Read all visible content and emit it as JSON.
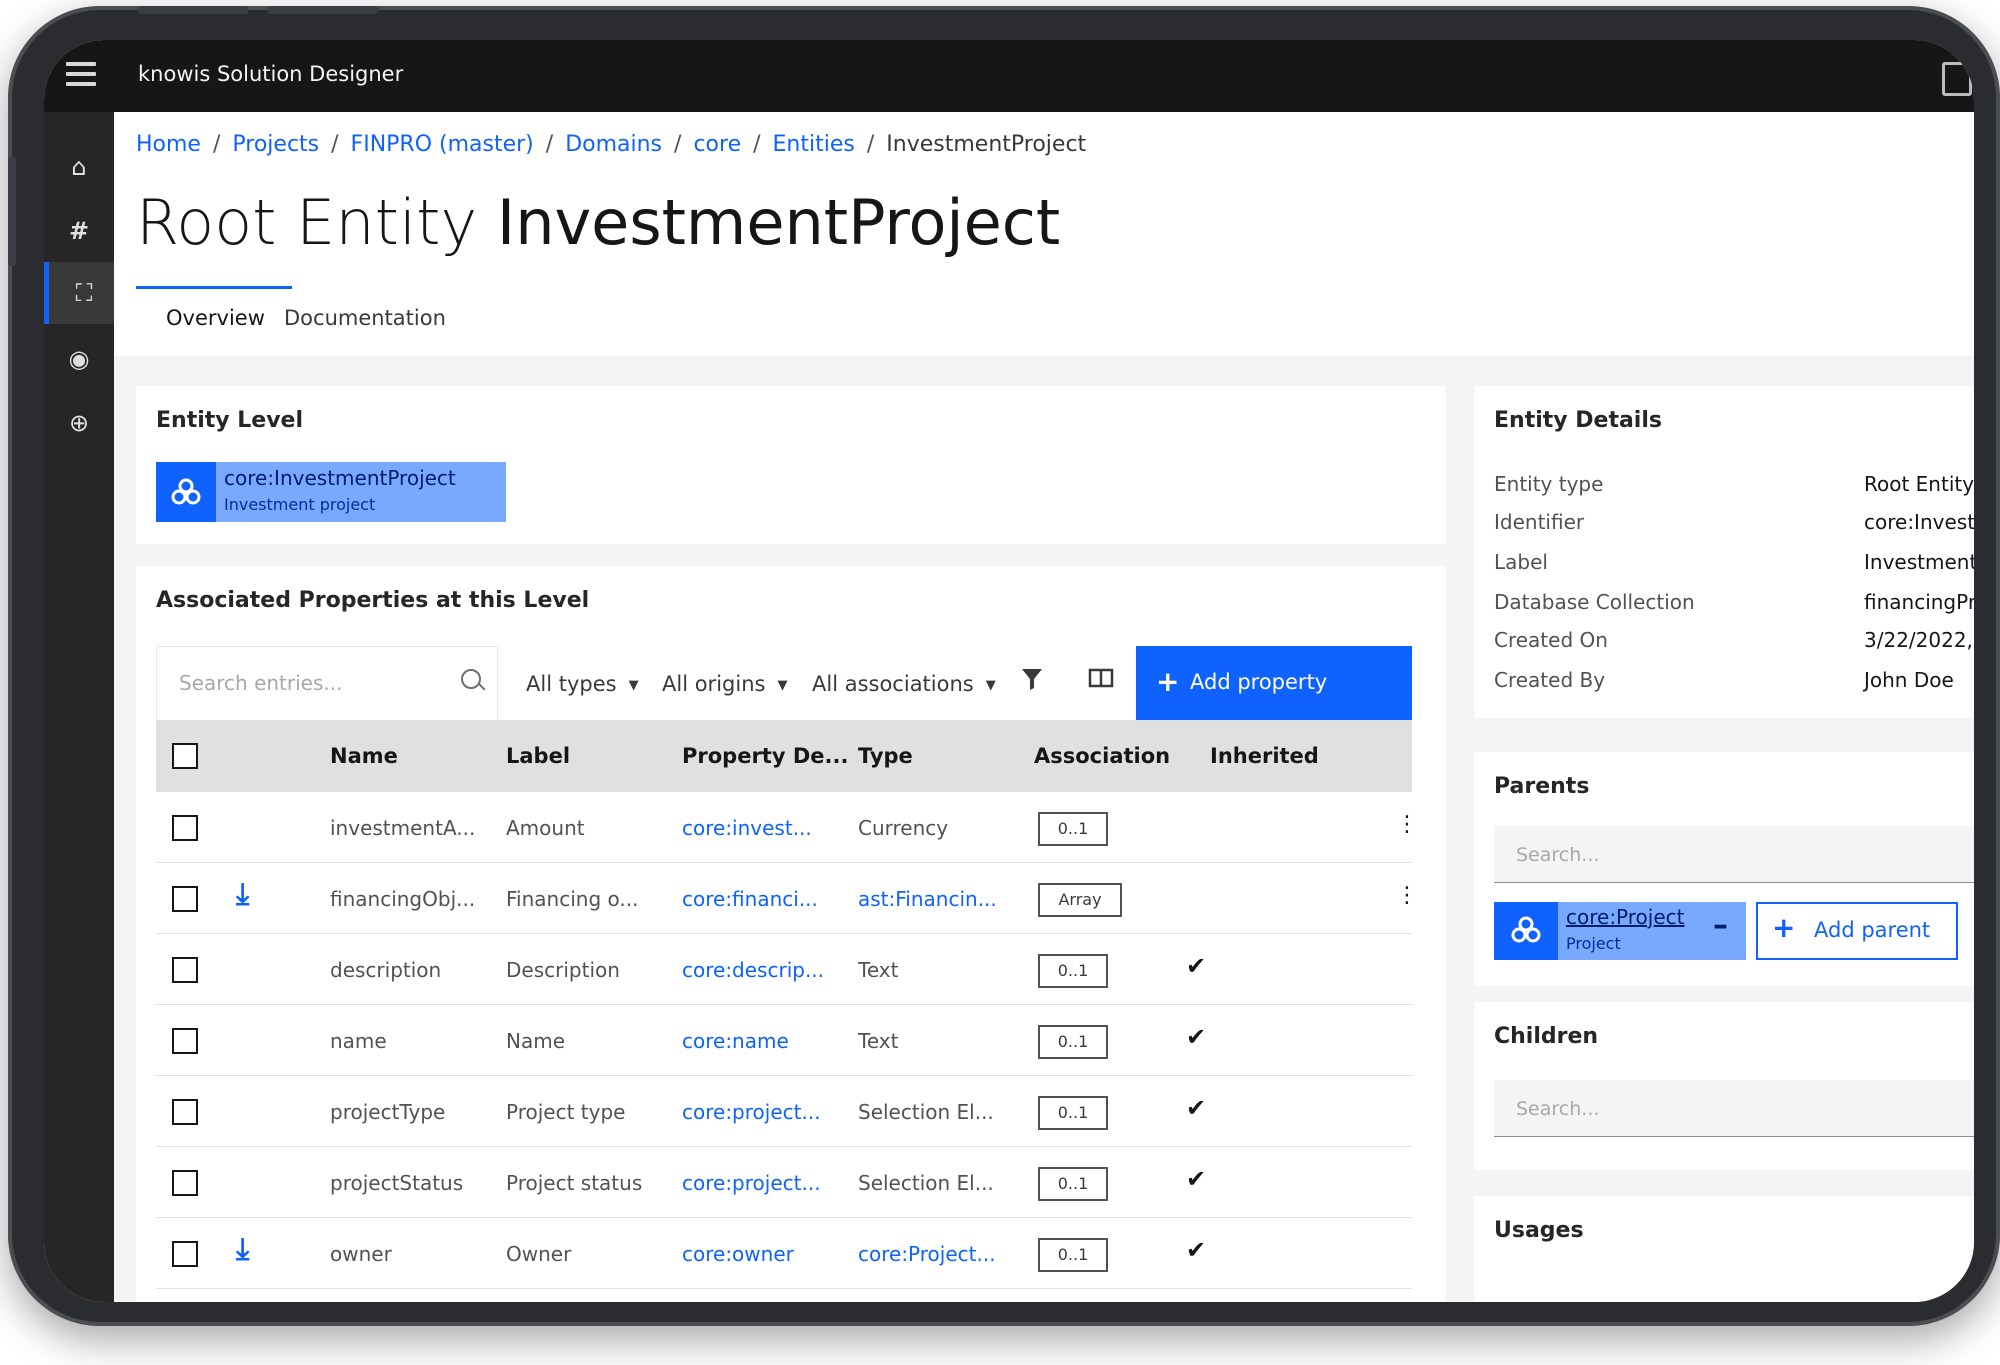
{
  "app": {
    "title": "knowis Solution Designer"
  },
  "sidenav": {
    "items": [
      {
        "name": "home",
        "glyph": "⌂"
      },
      {
        "name": "hash",
        "glyph": "#"
      },
      {
        "name": "focus",
        "glyph": "⛶"
      },
      {
        "name": "target",
        "glyph": "◉"
      },
      {
        "name": "crosshair",
        "glyph": "⊕"
      }
    ],
    "active": "focus"
  },
  "breadcrumb": {
    "home": "Home",
    "projects": "Projects",
    "project": "FINPRO (master)",
    "domains": "Domains",
    "domain": "core",
    "entities": "Entities",
    "current": "InvestmentProject",
    "sep": "/"
  },
  "page": {
    "title_prefix": "Root Entity",
    "title_name": "InvestmentProject"
  },
  "tabs": {
    "overview": "Overview",
    "documentation": "Documentation"
  },
  "entity_level": {
    "title": "Entity Level",
    "tag": {
      "id": "core:InvestmentProject",
      "label": "Investment project"
    }
  },
  "properties": {
    "title": "Associated Properties at this Level",
    "search_placeholder": "Search entries...",
    "filters": {
      "types": "All types",
      "origins": "All origins",
      "associations": "All associations"
    },
    "add_button": "Add property",
    "columns": {
      "name": "Name",
      "label": "Label",
      "property_def": "Property De...",
      "type": "Type",
      "association": "Association",
      "inherited": "Inherited"
    },
    "rows": [
      {
        "name": "investmentA...",
        "label": "Amount",
        "property_def": "core:invest...",
        "type": "Currency",
        "type_link": false,
        "association": "0..1",
        "inherited": "",
        "relation": "",
        "menu": "⋮"
      },
      {
        "name": "financingObj...",
        "label": "Financing o...",
        "property_def": "core:financi...",
        "type": "ast:Financin...",
        "type_link": true,
        "association": "Array",
        "inherited": "",
        "relation": "⤓",
        "menu": "⋮"
      },
      {
        "name": "description",
        "label": "Description",
        "property_def": "core:descrip...",
        "type": "Text",
        "type_link": false,
        "association": "0..1",
        "inherited": "✔",
        "relation": "",
        "menu": ""
      },
      {
        "name": "name",
        "label": "Name",
        "property_def": "core:name",
        "type": "Text",
        "type_link": false,
        "association": "0..1",
        "inherited": "✔",
        "relation": "",
        "menu": ""
      },
      {
        "name": "projectType",
        "label": "Project type",
        "property_def": "core:project...",
        "type": "Selection El...",
        "type_link": false,
        "association": "0..1",
        "inherited": "✔",
        "relation": "",
        "menu": ""
      },
      {
        "name": "projectStatus",
        "label": "Project status",
        "property_def": "core:project...",
        "type": "Selection El...",
        "type_link": false,
        "association": "0..1",
        "inherited": "✔",
        "relation": "",
        "menu": ""
      },
      {
        "name": "owner",
        "label": "Owner",
        "property_def": "core:owner",
        "type": "core:Project...",
        "type_link": true,
        "association": "0..1",
        "inherited": "✔",
        "relation": "⤓",
        "menu": ""
      }
    ]
  },
  "entity_details": {
    "title": "Entity Details",
    "fields": [
      {
        "label": "Entity type",
        "value": "Root Entity"
      },
      {
        "label": "Identifier",
        "value": "core:Invest"
      },
      {
        "label": "Label",
        "value": "Investment"
      },
      {
        "label": "Database Collection",
        "value": "financingPr"
      },
      {
        "label": "Created On",
        "value": "3/22/2022,"
      },
      {
        "label": "Created By",
        "value": "John Doe"
      }
    ]
  },
  "parents": {
    "title": "Parents",
    "search_placeholder": "Search...",
    "tag": {
      "id": "core:Project",
      "label": "Project"
    },
    "add_button": "Add parent"
  },
  "children": {
    "title": "Children",
    "search_placeholder": "Search..."
  },
  "usages": {
    "title": "Usages"
  },
  "colors": {
    "accent": "#0f62fe",
    "tag_bg": "#78a9ff",
    "topbar": "#161616"
  }
}
